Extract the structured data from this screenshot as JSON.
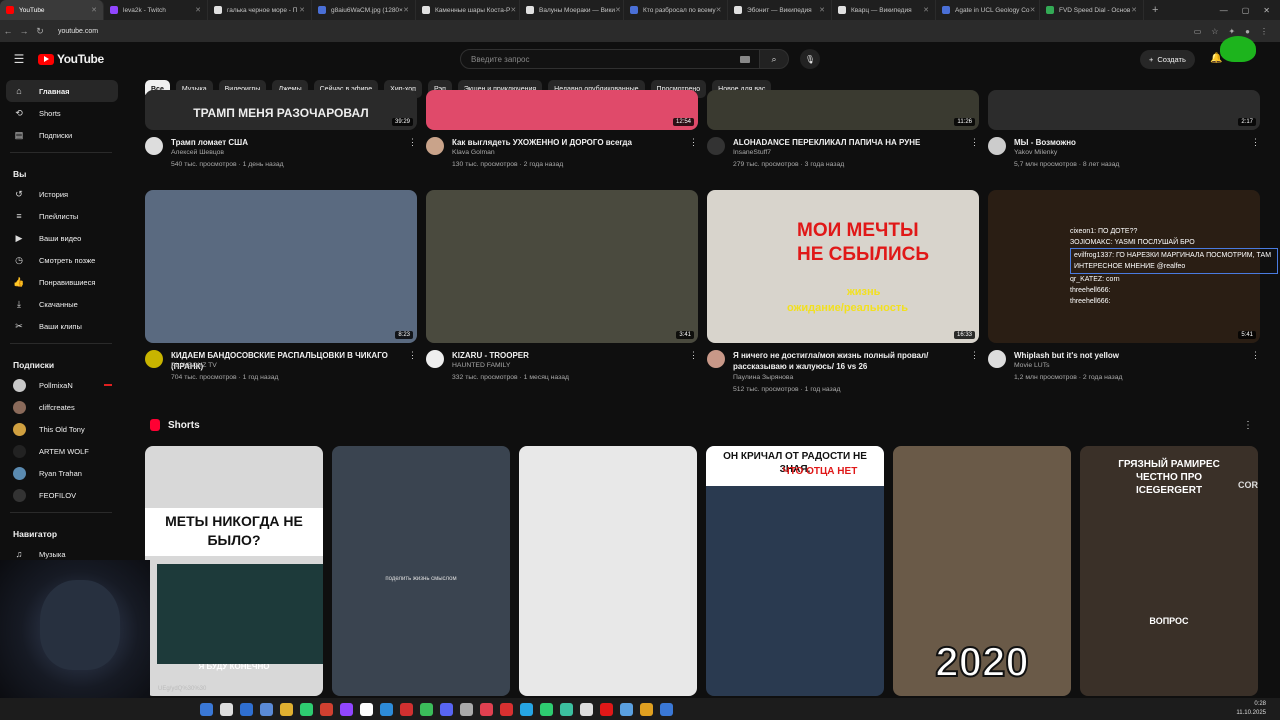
{
  "browser": {
    "tabs": [
      {
        "title": "YouTube",
        "color": "#ff0000",
        "active": true
      },
      {
        "title": "leva2k - Twitch",
        "color": "#9146ff"
      },
      {
        "title": "галька черное море - П",
        "color": "#e0e0e0"
      },
      {
        "title": "g8aiu6WaCM.jpg (1280×",
        "color": "#4a6fd6"
      },
      {
        "title": "Каменные шары Коста-Р",
        "color": "#e0e0e0"
      },
      {
        "title": "Валуны Моераки — Вики",
        "color": "#e0e0e0"
      },
      {
        "title": "Кто разбросал по всему",
        "color": "#4a6fd6"
      },
      {
        "title": "Эбонит — Википедия",
        "color": "#e0e0e0"
      },
      {
        "title": "Кварц — Википедия",
        "color": "#e0e0e0"
      },
      {
        "title": "Agate in UCL Geology Co",
        "color": "#4a6fd6"
      },
      {
        "title": "FVD Speed Dial - Основ",
        "color": "#33aa55"
      }
    ],
    "url": "youtube.com"
  },
  "header": {
    "logo_text": "YouTube",
    "search_placeholder": "Введите запрос",
    "create_label": "Создать"
  },
  "sidebar": {
    "main": [
      {
        "label": "Главная",
        "icon": "home-icon",
        "glyph": "⌂",
        "active": true
      },
      {
        "label": "Shorts",
        "icon": "shorts-icon",
        "glyph": "⟲"
      },
      {
        "label": "Подписки",
        "icon": "subscriptions-icon",
        "glyph": "▤"
      }
    ],
    "you_heading": "Вы",
    "you": [
      {
        "label": "История",
        "icon": "history-icon",
        "glyph": "↺"
      },
      {
        "label": "Плейлисты",
        "icon": "playlists-icon",
        "glyph": "≡"
      },
      {
        "label": "Ваши видео",
        "icon": "your-videos-icon",
        "glyph": "▶"
      },
      {
        "label": "Смотреть позже",
        "icon": "watch-later-icon",
        "glyph": "◷"
      },
      {
        "label": "Понравившиеся",
        "icon": "liked-icon",
        "glyph": "👍"
      },
      {
        "label": "Скачанные",
        "icon": "downloads-icon",
        "glyph": "⤓"
      },
      {
        "label": "Ваши клипы",
        "icon": "clips-icon",
        "glyph": "✂"
      }
    ],
    "subs_heading": "Подписки",
    "subs": [
      {
        "label": "PollmixaN",
        "color": "#c8c8c8",
        "live": true
      },
      {
        "label": "cliffcreates",
        "color": "#8a6a5a"
      },
      {
        "label": "This Old Tony",
        "color": "#d0a040"
      },
      {
        "label": "ARTEM WOLF",
        "color": "#222222"
      },
      {
        "label": "Ryan Trahan",
        "color": "#5a8ab0"
      },
      {
        "label": "FEOFILOV",
        "color": "#333333"
      }
    ],
    "nav_heading": "Навигатор",
    "nav": [
      {
        "label": "Музыка",
        "icon": "music-icon",
        "glyph": "♫"
      }
    ]
  },
  "chips": [
    "Все",
    "Музыка",
    "Видеоигры",
    "Джемы",
    "Сейчас в эфире",
    "Хип-хоп",
    "Рэп",
    "Экшен и приключения",
    "Недавно опубликованные",
    "Просмотрено",
    "Новое для вас"
  ],
  "row1": [
    {
      "title": "Трамп ломает США",
      "channel": "Алексей Шевцов",
      "stats": "540 тыс. просмотров · 1 день назад",
      "duration": "39:29",
      "thumb_color": "#2a2a2a",
      "av": "#dddddd",
      "banner": "ТРАМП МЕНЯ РАЗОЧАРОВАЛ"
    },
    {
      "title": "Как выглядеть УХОЖЕННО И ДОРОГО всегда",
      "channel": "Klava Golman",
      "stats": "130 тыс. просмотров · 2 года назад",
      "duration": "12:54",
      "thumb_color": "#e04a6a",
      "av": "#c9a38a"
    },
    {
      "title": "ALOHADANCE ПЕРЕКЛИКАЛ ПАПИЧА НА РУНЕ",
      "channel": "InsaneStuff7",
      "stats": "279 тыс. просмотров · 3 года назад",
      "duration": "11:26",
      "thumb_color": "#3a3a30",
      "av": "#333333"
    },
    {
      "title": "МЫ - Возможно",
      "channel": "Yakov Milenky",
      "stats": "5,7 млн просмотров · 8 лет назад",
      "duration": "2:17",
      "thumb_color": "#2c2c2c",
      "av": "#cccccc"
    }
  ],
  "row2": [
    {
      "title": "КИДАЕМ БАНДОСОВСКИЕ РАСПАЛЬЦОВКИ В ЧИКАГО (ПРАНК)",
      "channel": "PLAYBOYZ TV",
      "stats": "704 тыс. просмотров · 1 год назад",
      "duration": "8:23",
      "thumb_color": "#5a6a80",
      "av": "#c8b400"
    },
    {
      "title": "KIZARU - TROOPER",
      "channel": "HAUNTED FAMILY",
      "stats": "332 тыс. просмотров · 1 месяц назад",
      "duration": "3:41",
      "thumb_color": "#4a4a3e",
      "av": "#eeeeee"
    },
    {
      "title": "Я ничего не достигла/моя жизнь полный провал/ рассказываю и жалуюсь/ 16 vs 26",
      "channel": "Паулина Зырянова",
      "stats": "512 тыс. просмотров · 1 год назад",
      "duration": "16:33",
      "thumb_color": "#d8d4cc",
      "av": "#c89888",
      "overlay1": "МОИ МЕЧТЫ",
      "overlay2": "НЕ СБЫЛИСЬ",
      "overlay3": "жизнь",
      "overlay4": "ожидание/реальность"
    },
    {
      "title": "Whiplash but it's not yellow",
      "channel": "Movie LUTs",
      "stats": "1,2 млн просмотров · 2 года назад",
      "duration": "5:41",
      "thumb_color": "#2a1e14",
      "av": "#dddddd"
    }
  ],
  "chat": [
    {
      "text": "cixeon1: ПО ДОТЕ??"
    },
    {
      "text": "ЗОJIOMAKC: YASMI ПОСЛУШАЙ БРО"
    },
    {
      "text": "evilfrog1337: ГО НАРЕЗКИ МАРГИНАЛА ПОСМОТРИМ, ТАМ ИНТЕРЕСНОЕ МНЕНИЕ @realfeo",
      "highlight": true
    },
    {
      "text": "qr_KATEZ: corn"
    },
    {
      "text": "threehell666:"
    },
    {
      "text": "threehell666:"
    }
  ],
  "shorts": {
    "heading": "Shorts",
    "items": [
      {
        "color": "#d8d8d8",
        "text": "МЕТЫ НИКОГДА НЕ БЫЛО?",
        "caption": "Я БУДУ КОНЕЧНО"
      },
      {
        "color": "#3a4450",
        "text": "поделить жизнь смыслом"
      },
      {
        "color": "#e8e8e8",
        "text": ""
      },
      {
        "color": "#2a3a50",
        "text": "ОН КРИЧАЛ ОТ РАДОСТИ НЕ ЗНАЯ,",
        "text_accent": "ЧТО ОТЦА НЕТ"
      },
      {
        "color": "#6a5a48",
        "text": "2020"
      },
      {
        "color": "#3a3028",
        "text": "ГРЯЗНЫЙ РАМИРЕС ЧЕСТНО ПРО ICEGERGERT",
        "caption": "ВОПРОС",
        "corner": "COR"
      }
    ]
  },
  "segment_text": "UEg/ydQ%30%30",
  "clock": {
    "time": "0:28",
    "date": "11.10.2025"
  }
}
